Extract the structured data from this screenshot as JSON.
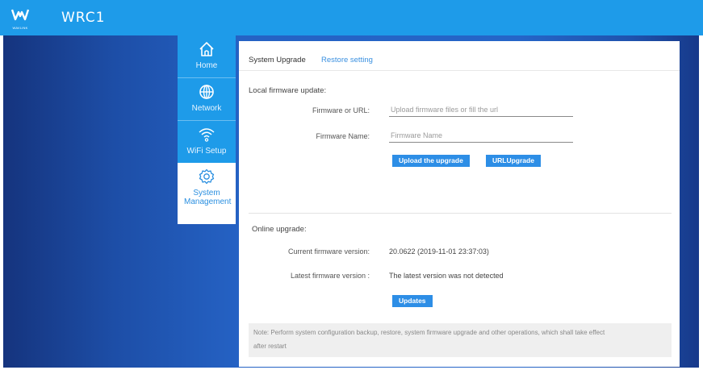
{
  "header": {
    "brand": "WRC1",
    "logo_caption": "WAVLINK",
    "background": "#1e9be9"
  },
  "sidebar": {
    "items": [
      {
        "label": "Home",
        "icon": "home-icon",
        "active": false
      },
      {
        "label": "Network",
        "icon": "globe-icon",
        "active": false
      },
      {
        "label": "WiFi Setup",
        "icon": "wifi-icon",
        "active": false
      },
      {
        "label": "System Management",
        "icon": "gear-icon",
        "active": true
      }
    ]
  },
  "tabs": [
    {
      "label": "System Upgrade",
      "active": true
    },
    {
      "label": "Restore setting",
      "active": false
    }
  ],
  "local": {
    "title": "Local firmware update:",
    "firmware_url_label": "Firmware or URL:",
    "firmware_url_placeholder": "Upload firmware files or fill the url",
    "firmware_name_label": "Firmware Name:",
    "firmware_name_placeholder": "Firmware Name",
    "upload_button": "Upload the upgrade",
    "url_button": "URLUpgrade"
  },
  "online": {
    "title": "Online upgrade:",
    "current_label": "Current firmware version:",
    "current_value": "20.0622  (2019-11-01 23:37:03)",
    "latest_label": "Latest firmware version :",
    "latest_value": "The latest version was not detected",
    "updates_button": "Updates"
  },
  "note": {
    "line1": "Note:  Perform system configuration backup, restore, system firmware upgrade and other operations, which shall take effect",
    "line2": "after restart"
  },
  "colors": {
    "accent": "#1e9be9",
    "button": "#2d8ee6",
    "tab_link": "#3a90e0"
  }
}
